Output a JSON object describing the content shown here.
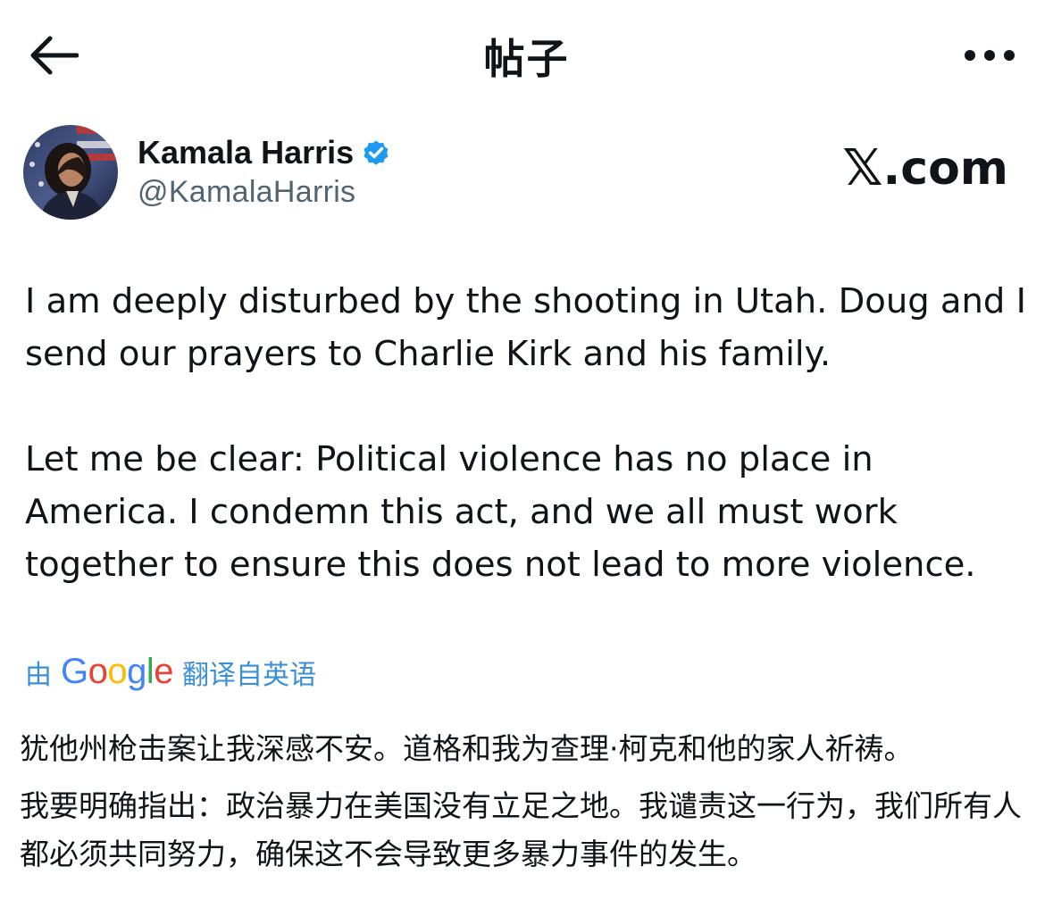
{
  "header": {
    "back_icon": "arrow-left-icon",
    "title": "帖子",
    "more_icon": "more-horizontal-icon"
  },
  "author": {
    "display_name": "Kamala Harris",
    "handle": "@KamalaHarris",
    "verified_icon": "verified-badge-icon",
    "verified_color": "#1d9bf0"
  },
  "watermark": {
    "text": "X.com",
    "x_glyph": "𝕏",
    "suffix": ".com"
  },
  "tweet": {
    "paragraphs": [
      "I am deeply disturbed by the shooting in Utah. Doug and I send our prayers to Charlie Kirk and his family.",
      "Let me be clear: Political violence has no place in America. I condemn this act, and we all must work together to ensure this does not lead to more violence."
    ]
  },
  "translation": {
    "prefix": "由",
    "provider": "Google",
    "suffix": "翻译自英语",
    "link_color": "#3b8fd6",
    "paragraphs": [
      "犹他州枪击案让我深感不安。道格和我为查理·柯克和他的家人祈祷。",
      "我要明确指出：政治暴力在美国没有立足之地。我谴责这一行为，我们所有人都必须共同努力，确保这不会导致更多暴力事件的发生。"
    ]
  }
}
